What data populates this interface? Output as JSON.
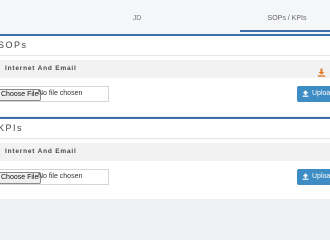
{
  "tabs": [
    {
      "label": "JD"
    },
    {
      "label": "SOPs / KPIs",
      "active": true
    }
  ],
  "sections": [
    {
      "title": "SOPs",
      "subheader": "Internet And Email",
      "download_icon": "download-icon",
      "file_input": {
        "button_label": "Choose File",
        "status": "No file chosen"
      },
      "upload_label": "Upload"
    },
    {
      "title": "KPIs",
      "subheader": "Internet And Email",
      "file_input": {
        "button_label": "Choose File",
        "status": "No file chosen"
      },
      "upload_label": "Upload"
    }
  ],
  "colors": {
    "accent": "#3b6fa8",
    "upload_button": "#3d8cc4",
    "download_icon": "#e07b24"
  }
}
